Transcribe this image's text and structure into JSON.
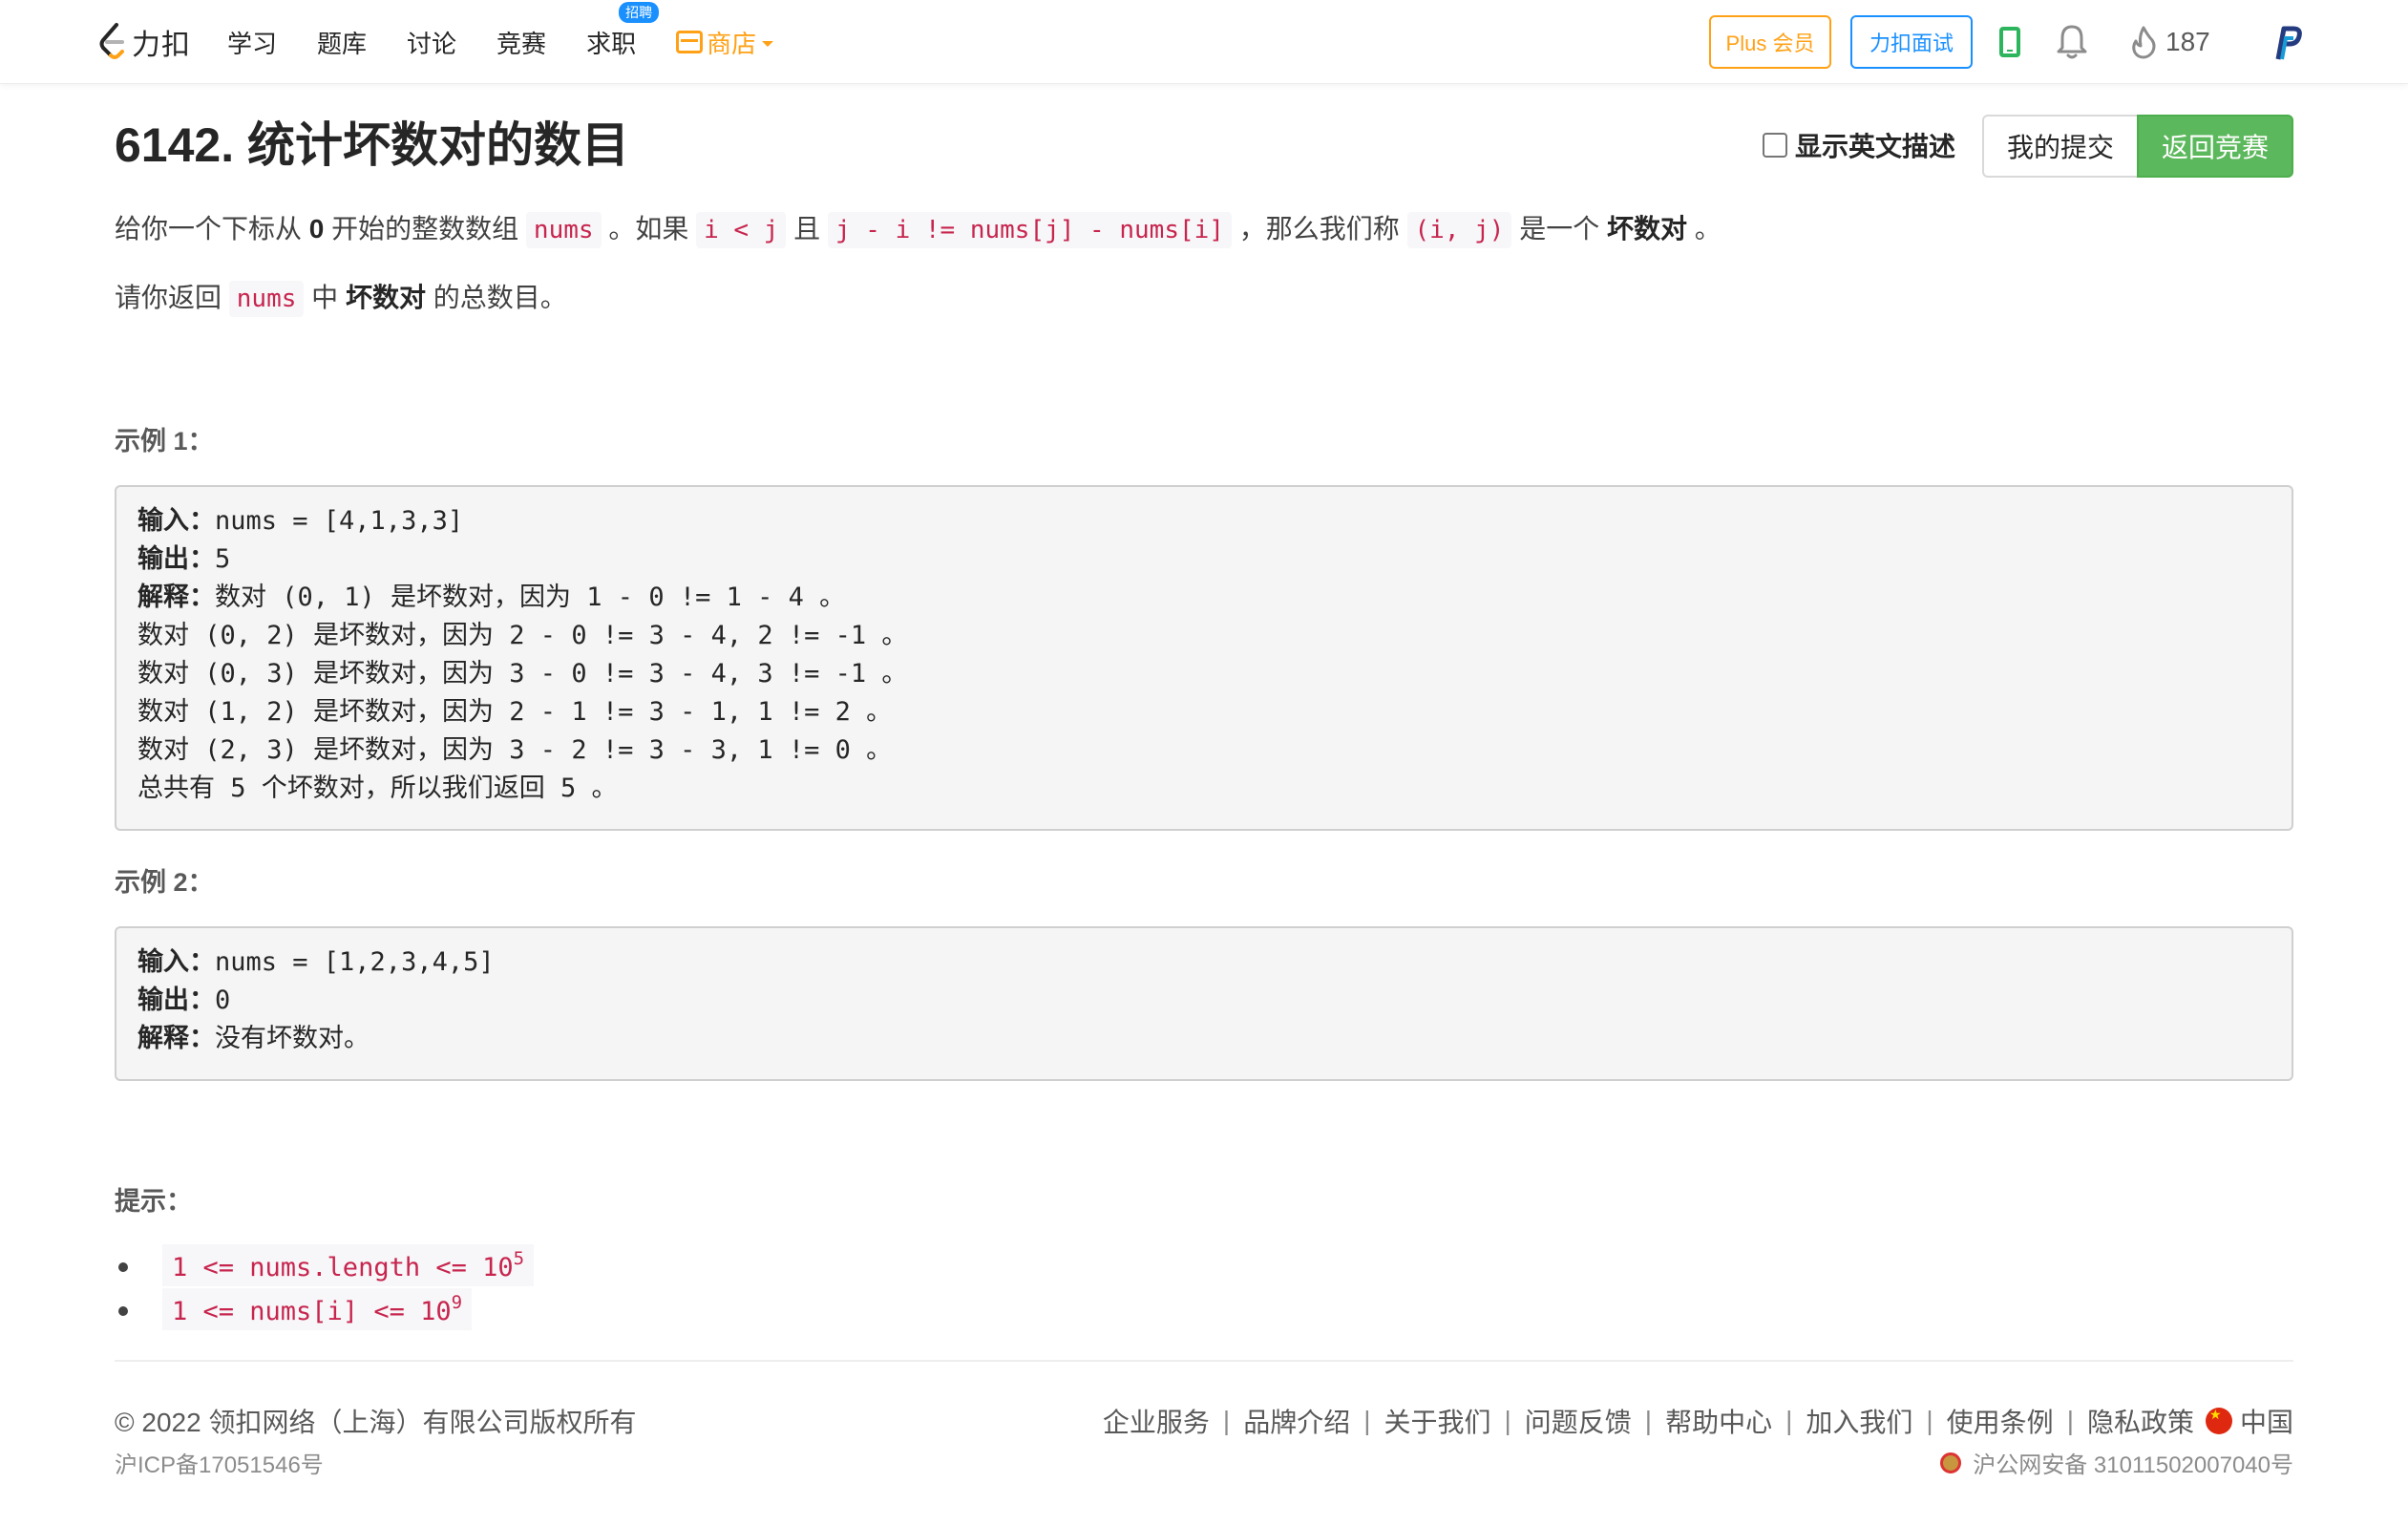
{
  "nav": {
    "logo_text": "力扣",
    "links": [
      "学习",
      "题库",
      "讨论",
      "竞赛",
      "求职"
    ],
    "jobs_badge": "招聘",
    "store": "商店",
    "plus": "Plus 会员",
    "interview": "力扣面试",
    "fire_count": "187",
    "colors": {
      "accent": "#ffa116",
      "blue": "#1a90ff",
      "green": "#2db55d"
    }
  },
  "problem": {
    "title": "6142. 统计坏数对的数目",
    "show_english": "显示英文描述",
    "my_submissions": "我的提交",
    "back_contest": "返回竞赛",
    "p1": {
      "t1": "给你一个下标从 ",
      "zero": "0",
      "t2": " 开始的整数数组 ",
      "c_nums": "nums",
      "t3": " 。如果 ",
      "c_ij": "i < j",
      "t4": " 且 ",
      "c_cond": "j - i != nums[j] - nums[i]",
      "t5": " ，那么我们称 ",
      "c_pair": "(i, j)",
      "t6": " 是一个 ",
      "bad_pair": "坏数对",
      "t7": " 。"
    },
    "p2": {
      "t1": "请你返回 ",
      "c_nums": "nums",
      "t2": " 中 ",
      "bad_pair": "坏数对",
      "t3": " 的总数目。"
    }
  },
  "example1": {
    "label": "示例 1：",
    "input_k": "输入：",
    "input_v": "nums = [4,1,3,3]",
    "output_k": "输出：",
    "output_v": "5",
    "explain_k": "解释：",
    "explain_v": "数对 (0, 1) 是坏数对，因为 1 - 0 != 1 - 4 。",
    "lines": [
      "数对 (0, 2) 是坏数对，因为 2 - 0 != 3 - 4, 2 != -1 。",
      "数对 (0, 3) 是坏数对，因为 3 - 0 != 3 - 4, 3 != -1 。",
      "数对 (1, 2) 是坏数对，因为 2 - 1 != 3 - 1, 1 != 2 。",
      "数对 (2, 3) 是坏数对，因为 3 - 2 != 3 - 3, 1 != 0 。",
      "总共有 5 个坏数对，所以我们返回 5 。"
    ]
  },
  "example2": {
    "label": "示例 2：",
    "input_k": "输入：",
    "input_v": "nums = [1,2,3,4,5]",
    "output_k": "输出：",
    "output_v": "0",
    "explain_k": "解释：",
    "explain_v": "没有坏数对。"
  },
  "hints": {
    "label": "提示：",
    "h1_base": "1 <= nums.length <= 10",
    "h1_exp": "5",
    "h2_base": "1 <= nums[i] <= 10",
    "h2_exp": "9"
  },
  "footer": {
    "copyright": "© 2022 领扣网络（上海）有限公司版权所有",
    "icp": "沪ICP备17051546号",
    "links": [
      "企业服务",
      "品牌介绍",
      "关于我们",
      "问题反馈",
      "帮助中心",
      "加入我们",
      "使用条例",
      "隐私政策"
    ],
    "region": "中国",
    "police": "沪公网安备 31011502007040号"
  }
}
